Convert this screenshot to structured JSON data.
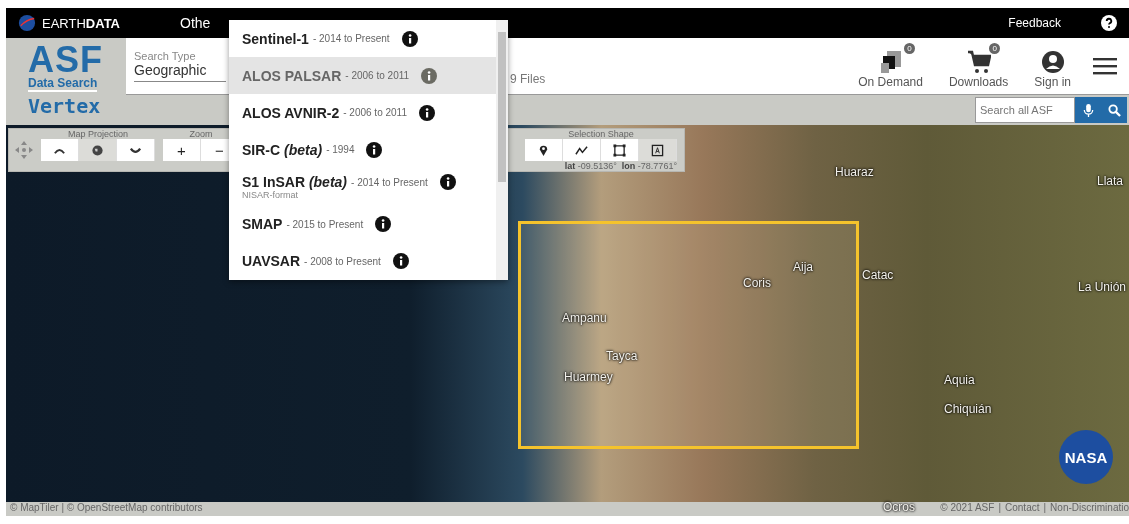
{
  "top_bar": {
    "brand": "EARTH**DATA**",
    "menu_item": "Othe",
    "feedback": "Feedback"
  },
  "header": {
    "logo": {
      "title": "ASF",
      "subtitle": "Data Search",
      "product": "Vertex"
    },
    "search_type": {
      "label": "Search Type",
      "value": "Geographic"
    },
    "files": "9 Files",
    "actions": [
      {
        "kind": "ondemand",
        "label": "On Demand",
        "badge": "0"
      },
      {
        "kind": "cart",
        "label": "Downloads",
        "badge": "0"
      },
      {
        "kind": "user",
        "label": "Sign in"
      }
    ]
  },
  "site_search": {
    "placeholder": "Search all ASF"
  },
  "map_toolbar": {
    "projection": {
      "label": "Map Projection",
      "options": [
        {
          "kind": "arctic",
          "selected": false
        },
        {
          "kind": "equatorial",
          "selected": true
        },
        {
          "kind": "antarctic",
          "selected": false
        }
      ]
    },
    "zoom": {
      "label": "Zoom",
      "buttons": [
        "+",
        "−"
      ]
    },
    "selection": {
      "label": "Selection Shape",
      "shapes": [
        {
          "kind": "point",
          "selected": false
        },
        {
          "kind": "line",
          "selected": false
        },
        {
          "kind": "polygon",
          "selected": false
        },
        {
          "kind": "box",
          "selected": true
        }
      ]
    },
    "lat_label": "lat",
    "lat": "-09.5136°",
    "lon_label": "lon",
    "lon": "-78.7761°"
  },
  "dataset_menu": {
    "items": [
      {
        "name": "Sentinel-1",
        "dates": "- 2014 to Present",
        "selected": false
      },
      {
        "name": "ALOS PALSAR",
        "dates": "- 2006 to 2011",
        "selected": true
      },
      {
        "name": "ALOS AVNIR-2",
        "dates": "- 2006 to 2011",
        "selected": false
      },
      {
        "name": "SIR-C *(beta)*",
        "dates": "- 1994",
        "selected": false
      },
      {
        "name": "S1 InSAR *(beta)*",
        "dates": "- 2014 to Present",
        "note": "NISAR-format",
        "selected": false
      },
      {
        "name": "SMAP",
        "dates": "- 2015 to Present",
        "selected": false
      },
      {
        "name": "UAVSAR",
        "dates": "- 2008 to Present",
        "selected": false
      }
    ]
  },
  "map": {
    "places": [
      "Huaraz",
      "Llata",
      "Aija",
      "Coris",
      "Catac",
      "La Unión",
      "Ampanu",
      "Tayca",
      "Huarmey",
      "Aquia",
      "Chiquián",
      "Ocros"
    ],
    "logo": "NASA"
  },
  "footer": {
    "attribution": "© MapTiler | © OpenStreetMap contributors",
    "copyright": "© 2021 ASF",
    "separator": "|",
    "links": [
      "Contact",
      "Non-Discriminatio"
    ]
  }
}
